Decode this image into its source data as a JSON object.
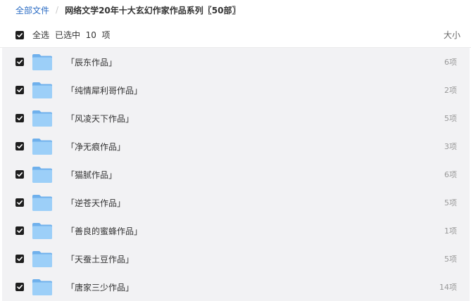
{
  "breadcrumb": {
    "root": "全部文件",
    "separator": "/",
    "current": "网络文学20年十大玄幻作家作品系列〖50部〗"
  },
  "header": {
    "select_all": "全选",
    "selected": "已选中  10  项",
    "size_label": "大小"
  },
  "files": [
    {
      "name": "「辰东作品」",
      "size": "6项"
    },
    {
      "name": "「纯情犀利哥作品」",
      "size": "2项"
    },
    {
      "name": "「风凌天下作品」",
      "size": "5项"
    },
    {
      "name": "「净无痕作品」",
      "size": "3项"
    },
    {
      "name": "「猫腻作品」",
      "size": "6项"
    },
    {
      "name": "「逆苍天作品」",
      "size": "5项"
    },
    {
      "name": "「善良的蜜蜂作品」",
      "size": "1项"
    },
    {
      "name": "「天蚕土豆作品」",
      "size": "5项"
    },
    {
      "name": "「唐家三少作品」",
      "size": "14项"
    }
  ],
  "icons": {
    "checkbox": "checkbox-checked-icon",
    "folder": "folder-icon"
  },
  "colors": {
    "link": "#2b6cc4",
    "checkbox": "#1e1e1e",
    "folder": "#8cc4f4",
    "list_background": "#f2f2f4"
  }
}
